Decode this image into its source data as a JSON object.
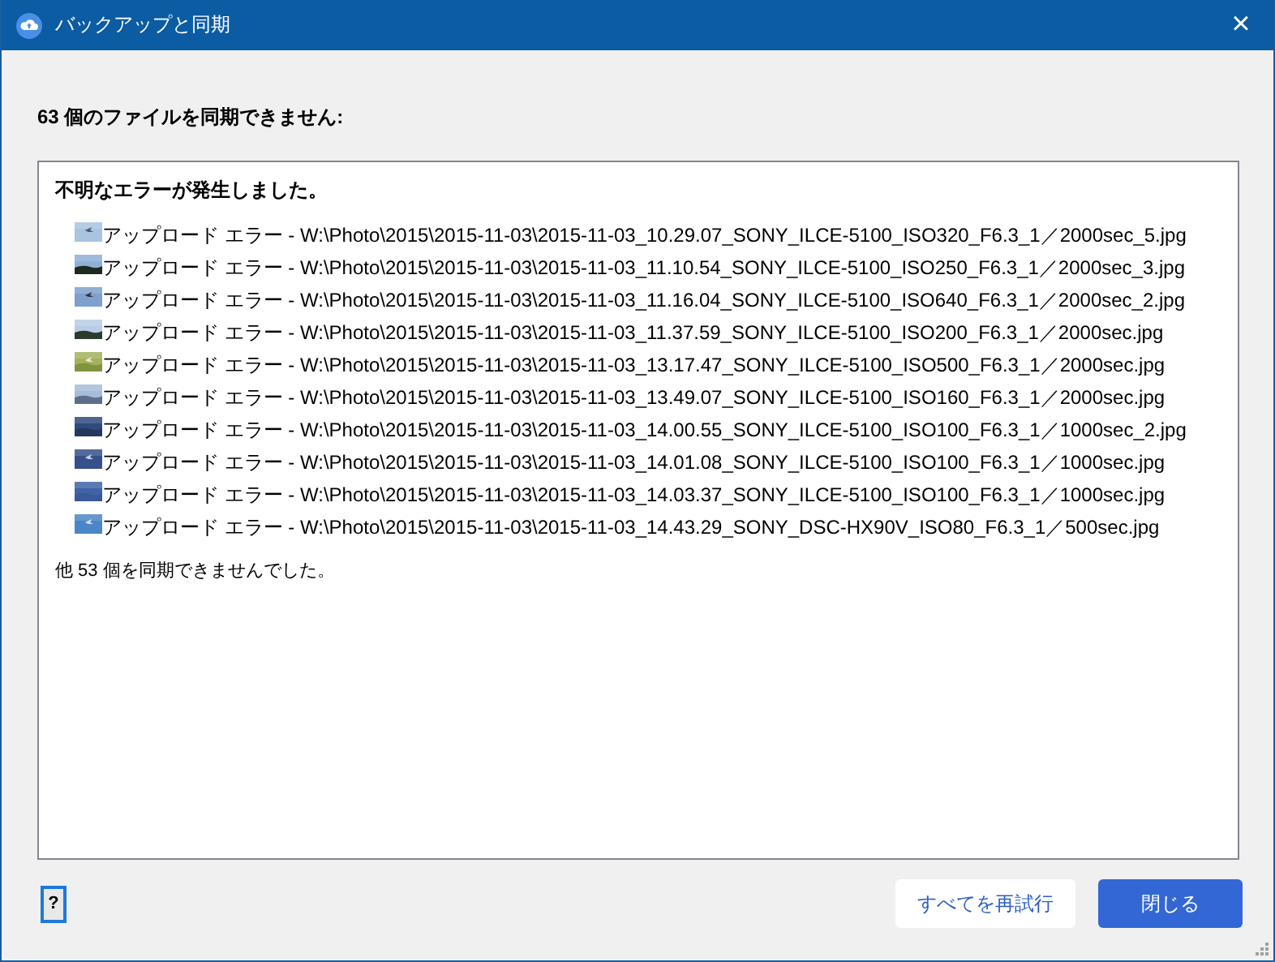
{
  "window": {
    "title": "バックアップと同期",
    "close": "×"
  },
  "heading": "63 個のファイルを同期できません:",
  "error_box": {
    "message": "不明なエラーが発生しました。",
    "files": [
      {
        "text": "アップロード エラー - W:\\Photo\\2015\\2015-11-03\\2015-11-03_10.29.07_SONY_ILCE-5100_ISO320_F6.3_1／2000sec_5.jpg"
      },
      {
        "text": "アップロード エラー - W:\\Photo\\2015\\2015-11-03\\2015-11-03_11.10.54_SONY_ILCE-5100_ISO250_F6.3_1／2000sec_3.jpg"
      },
      {
        "text": "アップロード エラー - W:\\Photo\\2015\\2015-11-03\\2015-11-03_11.16.04_SONY_ILCE-5100_ISO640_F6.3_1／2000sec_2.jpg"
      },
      {
        "text": "アップロード エラー - W:\\Photo\\2015\\2015-11-03\\2015-11-03_11.37.59_SONY_ILCE-5100_ISO200_F6.3_1／2000sec.jpg"
      },
      {
        "text": "アップロード エラー - W:\\Photo\\2015\\2015-11-03\\2015-11-03_13.17.47_SONY_ILCE-5100_ISO500_F6.3_1／2000sec.jpg"
      },
      {
        "text": "アップロード エラー - W:\\Photo\\2015\\2015-11-03\\2015-11-03_13.49.07_SONY_ILCE-5100_ISO160_F6.3_1／2000sec.jpg"
      },
      {
        "text": "アップロード エラー - W:\\Photo\\2015\\2015-11-03\\2015-11-03_14.00.55_SONY_ILCE-5100_ISO100_F6.3_1／1000sec_2.jpg"
      },
      {
        "text": "アップロード エラー - W:\\Photo\\2015\\2015-11-03\\2015-11-03_14.01.08_SONY_ILCE-5100_ISO100_F6.3_1／1000sec.jpg"
      },
      {
        "text": "アップロード エラー - W:\\Photo\\2015\\2015-11-03\\2015-11-03_14.03.37_SONY_ILCE-5100_ISO100_F6.3_1／1000sec.jpg"
      },
      {
        "text": "アップロード エラー - W:\\Photo\\2015\\2015-11-03\\2015-11-03_14.43.29_SONY_DSC-HX90V_ISO80_F6.3_1／500sec.jpg"
      }
    ],
    "more": "他 53 個を同期できませんでした。"
  },
  "help_button": "?",
  "buttons": [
    {
      "label": "すべてを再試行",
      "kind": "secondary"
    },
    {
      "label": "閉じる",
      "kind": "primary"
    }
  ]
}
